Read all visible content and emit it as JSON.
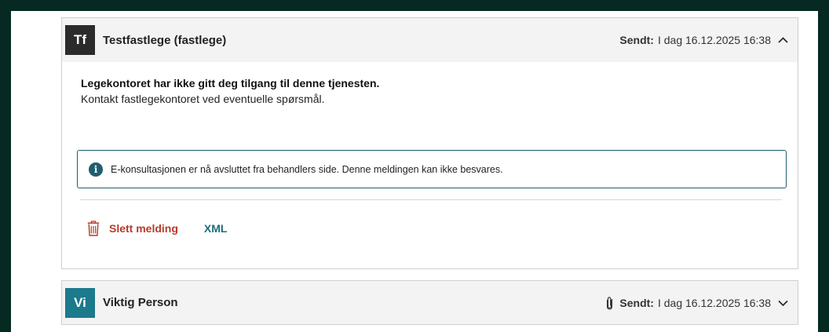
{
  "messages": [
    {
      "avatar_initials": "Tf",
      "avatar_color": "#2b2b2b",
      "sender": "Testfastlege (fastlege)",
      "sent_label": "Sendt:",
      "sent_value": "I dag 16.12.2025 16:38",
      "expanded": true,
      "body_bold": "Legekontoret har ikke gitt deg tilgang til denne tjenesten.",
      "body_text": "Kontakt fastlegekontoret ved eventuelle spørsmål.",
      "info_text": "E-konsultasjonen er nå avsluttet fra behandlers side. Denne meldingen kan ikke besvares.",
      "delete_label": "Slett melding",
      "xml_label": "XML"
    },
    {
      "avatar_initials": "Vi",
      "avatar_color": "#1b7a8c",
      "sender": "Viktig Person",
      "sent_label": "Sendt:",
      "sent_value": "I dag 16.12.2025 16:38",
      "expanded": false,
      "has_attachment": true
    }
  ],
  "icons": {
    "chevron_up": "chevron-up-icon",
    "chevron_down": "chevron-down-icon",
    "info": "info-icon",
    "trash": "trash-icon",
    "paperclip": "paperclip-icon"
  },
  "colors": {
    "frame": "#062a22",
    "info_border": "#1e5e70",
    "delete": "#b83a29",
    "link": "#1b6f7e"
  }
}
